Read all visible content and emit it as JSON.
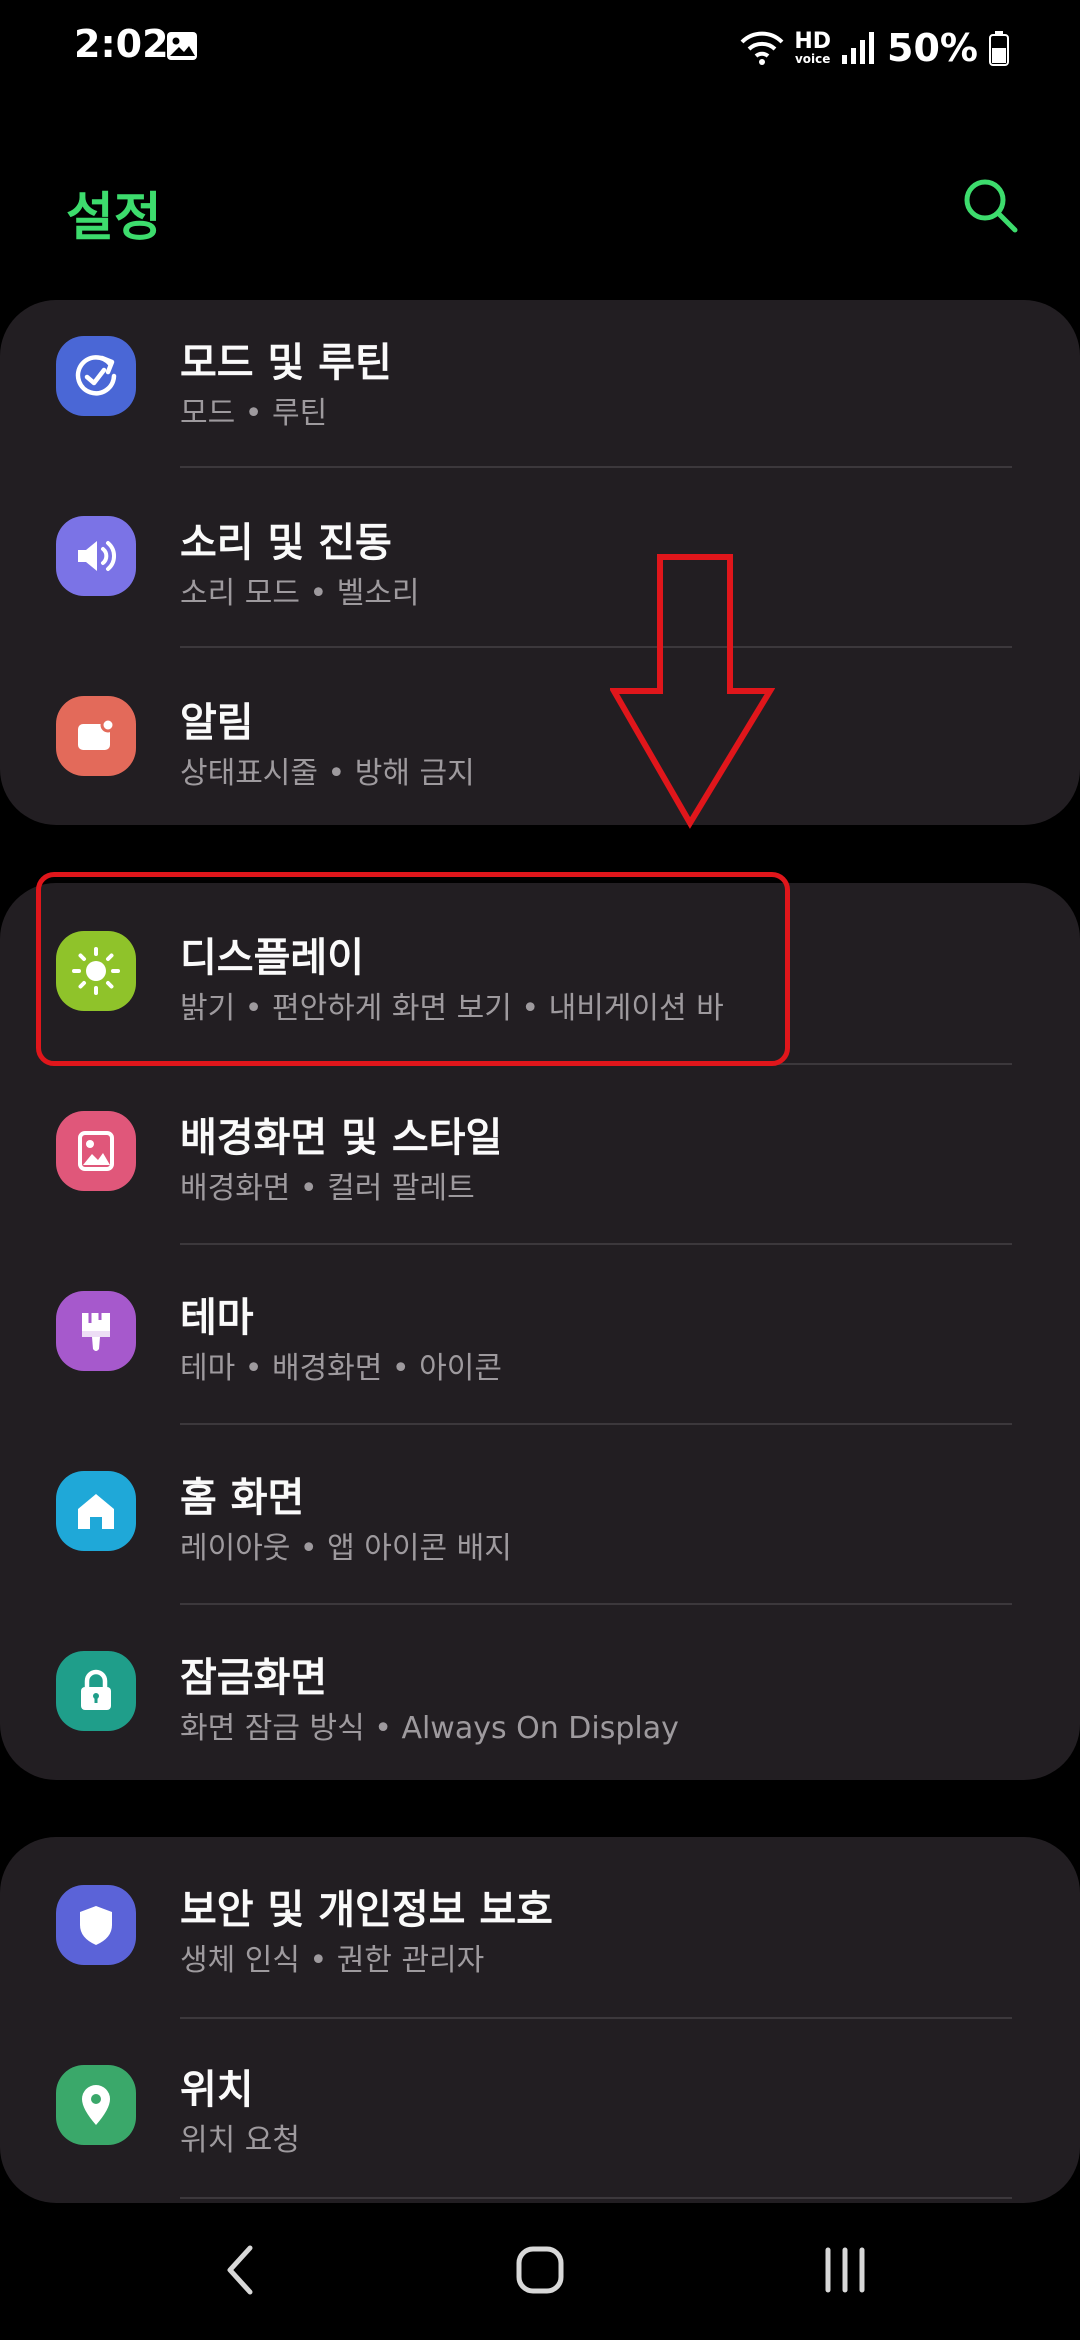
{
  "status_bar": {
    "time": "2:02",
    "hd_label": "HD",
    "voice_label": "voice",
    "battery_percent": "50%"
  },
  "header": {
    "title": "설정",
    "accent_color": "#3ddc6d"
  },
  "groups": [
    {
      "items": [
        {
          "title": "모드 및 루틴",
          "subtitle": "모드 • 루틴",
          "icon": "modes-routines-icon",
          "icon_color": "#4a67d6"
        },
        {
          "title": "소리 및 진동",
          "subtitle": "소리 모드 • 벨소리",
          "icon": "speaker-icon",
          "icon_color": "#7b73e6"
        },
        {
          "title": "알림",
          "subtitle": "상태표시줄 • 방해 금지",
          "icon": "notification-icon",
          "icon_color": "#e36a5a"
        }
      ]
    },
    {
      "items": [
        {
          "title": "디스플레이",
          "subtitle": "밝기 • 편안하게 화면 보기 • 내비게이션 바",
          "icon": "sun-icon",
          "icon_color": "#8fc32a"
        },
        {
          "title": "배경화면 및 스타일",
          "subtitle": "배경화면 • 컬러 팔레트",
          "icon": "wallpaper-icon",
          "icon_color": "#e0577a"
        },
        {
          "title": "테마",
          "subtitle": "테마 • 배경화면 • 아이콘",
          "icon": "paintbrush-icon",
          "icon_color": "#a659cc"
        },
        {
          "title": "홈 화면",
          "subtitle": "레이아웃 • 앱 아이콘 배지",
          "icon": "home-icon",
          "icon_color": "#1fa8d8"
        },
        {
          "title": "잠금화면",
          "subtitle": "화면 잠금 방식 • Always On Display",
          "icon": "lock-icon",
          "icon_color": "#1f9e8a"
        }
      ]
    },
    {
      "items": [
        {
          "title": "보안 및 개인정보 보호",
          "subtitle": "생체 인식 • 권한 관리자",
          "icon": "shield-icon",
          "icon_color": "#5b63d8"
        },
        {
          "title": "위치",
          "subtitle": "위치 요청",
          "icon": "location-pin-icon",
          "icon_color": "#3aa86a"
        }
      ]
    }
  ],
  "annotation": {
    "highlight_color": "#e0161b"
  },
  "nav_bar": {
    "back": "back-icon",
    "home": "home-button-icon",
    "recents": "recents-icon"
  }
}
